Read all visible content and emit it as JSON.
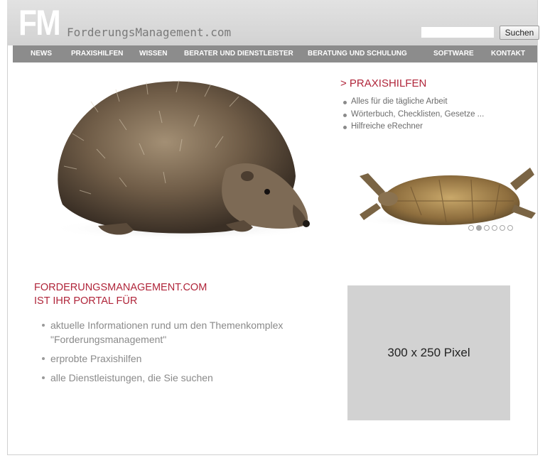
{
  "logo": {
    "mark": "FM",
    "domain": "ForderungsManagement.com"
  },
  "search": {
    "placeholder": "",
    "button_label": "Suchen"
  },
  "nav": {
    "items": [
      {
        "label": "NEWS"
      },
      {
        "label": "PRAXISHILFEN"
      },
      {
        "label": "WISSEN"
      },
      {
        "label": "BERATER UND DIENSTLEISTER"
      },
      {
        "label": "BERATUNG UND SCHULUNG"
      },
      {
        "label": "SOFTWARE"
      },
      {
        "label": "KONTAKT"
      }
    ]
  },
  "hero": {
    "title": "> PRAXISHILFEN",
    "bullets": [
      "Alles für die tägliche Arbeit",
      "Wörterbuch, Checklisten, Gesetze ...",
      "Hilfreiche eRechner"
    ],
    "slide_count": 6,
    "active_slide": 2
  },
  "portal": {
    "title_line1": "FORDERUNGSMANAGEMENT.COM",
    "title_line2": "IST IHR PORTAL FÜR",
    "bullets": [
      "aktuelle Informationen rund um den Themenkomplex \"Forderungsmanagement\"",
      "erprobte Praxishilfen",
      "alle Dienstleistungen, die Sie suchen"
    ]
  },
  "ad": {
    "label": "300 x 250 Pixel"
  },
  "colors": {
    "accent": "#b0253a",
    "nav_bg": "#8c8c8c",
    "header_bg": "#d8d8d8",
    "ad_bg": "#d2d2d2"
  },
  "icons": {
    "bullet": "bullet-dot-icon",
    "slider": "slider-dot-icon"
  }
}
